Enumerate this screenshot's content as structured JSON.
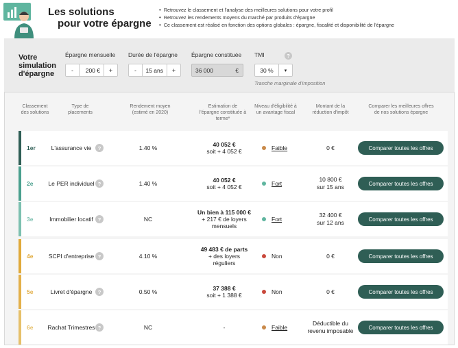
{
  "header": {
    "title_line1": "Les solutions",
    "title_line2": "pour votre épargne",
    "bullets": [
      "Retrouvez le classement et l'analyse des meilleures solutions pour votre profil",
      "Retrouvez les rendements moyens du marché par produits d'épargne",
      "Ce classement est réalisé en fonction des options globales : épargne, fiscalité et disponibilité de l'épargne"
    ]
  },
  "simulation": {
    "title_lines": [
      "Votre",
      "simulation",
      "d'épargne"
    ],
    "monthly": {
      "label": "Épargne mensuelle",
      "value": "200 €",
      "minus": "-",
      "plus": "+"
    },
    "duration": {
      "label": "Durée de l'épargne",
      "value": "15 ans",
      "minus": "-",
      "plus": "+"
    },
    "constituted": {
      "label": "Épargne constituée",
      "value": "36 000",
      "currency": "€"
    },
    "tmi": {
      "label": "TMI",
      "help": "?",
      "value": "30 %",
      "dropdown": "▾",
      "note": "Tranche marginale d'imposition"
    }
  },
  "results": {
    "headers": {
      "rank": [
        "Classement",
        "des solutions"
      ],
      "type": [
        "Type de",
        "placements"
      ],
      "rend": [
        "Rendement moyen",
        "(estimé en 2020)"
      ],
      "est": [
        "Estimation de",
        "l'épargne constituée à",
        "terme*"
      ],
      "lvl": [
        "Niveau d'éligibilité à",
        "un avantage fiscal"
      ],
      "mont": [
        "Montant de la",
        "réduction d'impôt"
      ],
      "cta": [
        "Comparer les meilleures offres",
        "de nos solutions épargne"
      ]
    },
    "cta_label": "Comparer toutes les offres",
    "help": "?",
    "rows": [
      {
        "rank": "1er",
        "type": "L'assurance vie",
        "rend": "1.40 %",
        "est_bold": "40 052 €",
        "est_rest": [
          "soit + 4 052 €"
        ],
        "lvl": "Faible",
        "lvl_link": true,
        "mont": [
          "0 €"
        ],
        "bar_color": "#2f5e55",
        "dot_color": "#c98a4a"
      },
      {
        "rank": "2e",
        "type": "Le PER individuel",
        "rend": "1.40 %",
        "est_bold": "40 052 €",
        "est_rest": [
          "soit + 4 052 €"
        ],
        "lvl": "Fort",
        "lvl_link": true,
        "mont": [
          "10 800 €",
          "sur 15 ans"
        ],
        "bar_color": "#4aa08e",
        "dot_color": "#5fb59f"
      },
      {
        "rank": "3e",
        "type": "Immobilier locatif",
        "rend": "NC",
        "est_bold": "Un bien à 115 000 €",
        "est_rest": [
          "+ 217 € de loyers",
          "mensuels"
        ],
        "lvl": "Fort",
        "lvl_link": true,
        "mont": [
          "32 400 €",
          "sur 12 ans"
        ],
        "bar_color": "#7cc0b0",
        "dot_color": "#5fb59f"
      },
      {
        "rank": "4e",
        "type": "SCPI d'entreprise",
        "rend": "4.10 %",
        "est_bold": "49 483 € de parts",
        "est_rest": [
          "+ des loyers",
          "réguliers"
        ],
        "lvl": "Non",
        "lvl_link": false,
        "mont": [
          "0 €"
        ],
        "bar_color": "#e0a93a",
        "dot_color": "#c9483b"
      },
      {
        "rank": "5e",
        "type": "Livret d'épargne",
        "rend": "0.50 %",
        "est_bold": "37 388 €",
        "est_rest": [
          "soit + 1 388 €"
        ],
        "lvl": "Non",
        "lvl_link": false,
        "mont": [
          "0 €"
        ],
        "bar_color": "#e3b04a",
        "dot_color": "#c9483b"
      },
      {
        "rank": "6e",
        "type": "Rachat Trimestres",
        "rend": "NC",
        "est_bold": "",
        "est_rest": [
          "-"
        ],
        "lvl": "Faible",
        "lvl_link": true,
        "mont": [
          "Déductible du",
          "revenu imposable"
        ],
        "bar_color": "#e6c06a",
        "dot_color": "#c98a4a"
      }
    ]
  }
}
